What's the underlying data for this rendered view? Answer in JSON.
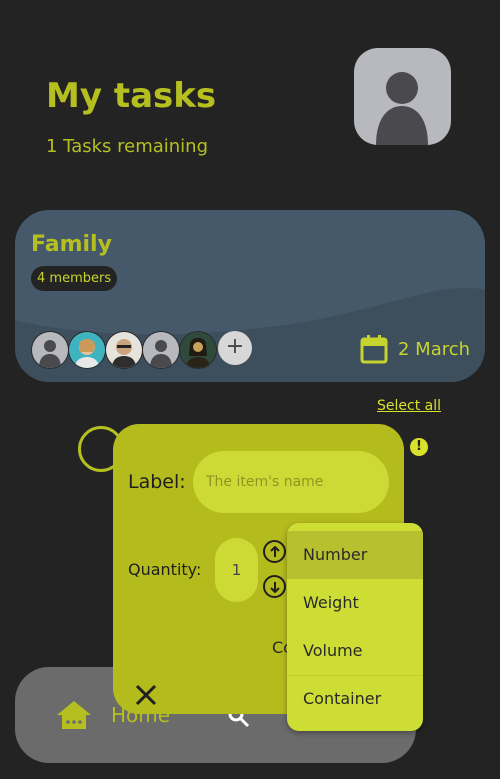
{
  "header": {
    "title": "My tasks",
    "subtitle": "1 Tasks remaining",
    "profile_icon": "person-icon"
  },
  "group_card": {
    "name": "Family",
    "members_badge": "4 members",
    "date": "2 March",
    "add_member_symbol": "+",
    "calendar_icon": "calendar-icon",
    "background_color": "#46596a"
  },
  "list": {
    "select_all_label": "Select all",
    "alert_symbol": "!"
  },
  "bottom_nav": {
    "home_label": "Home",
    "home_icon": "home-icon",
    "search_icon": "search-icon"
  },
  "add_item_dialog": {
    "label_text": "Label:",
    "name_placeholder": "The item's name",
    "quantity_text": "Quantity:",
    "quantity_value": "1",
    "confirm_label_partial": "Co",
    "close_icon": "close-icon",
    "increase_icon": "arrow-up-icon",
    "decrease_icon": "arrow-down-icon"
  },
  "unit_menu": {
    "items": [
      "Number",
      "Weight",
      "Volume",
      "Container"
    ],
    "selected": "Number"
  },
  "colors": {
    "background": "#232323",
    "accent": "#b5c020",
    "dialog": "#b4bb1c",
    "menu": "#cedd34"
  }
}
